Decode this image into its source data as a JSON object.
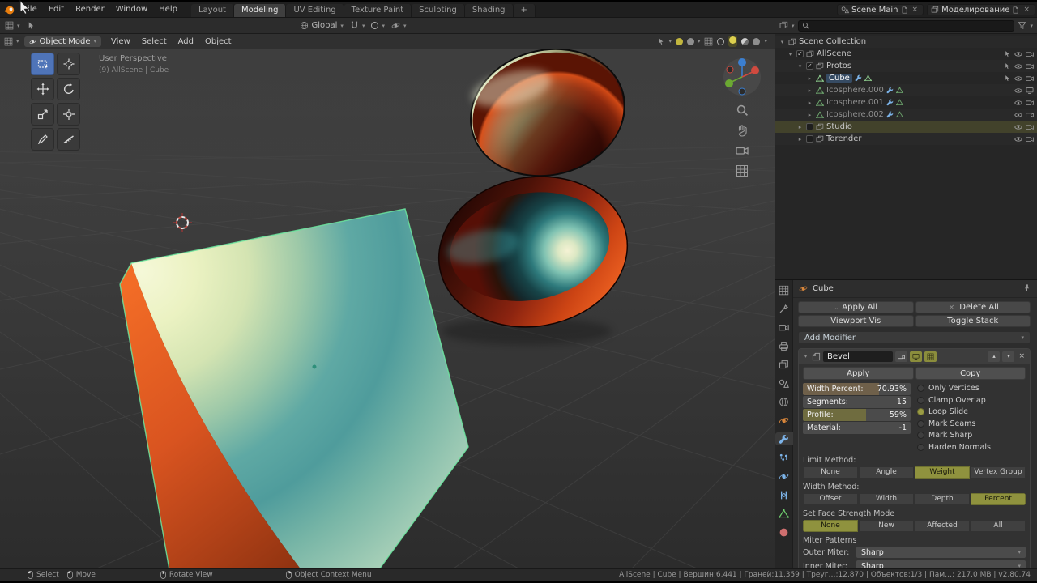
{
  "colors": {
    "active_tool": "#4f74b8",
    "olive_active": "#8f923e",
    "selection_outline": "#6ce8a0",
    "object_orange": "#d8863b",
    "tab_blue": "#7cb3e8"
  },
  "topbar": {
    "menus": [
      "File",
      "Edit",
      "Render",
      "Window",
      "Help"
    ],
    "workspaces": [
      "Layout",
      "Modeling",
      "UV Editing",
      "Texture Paint",
      "Sculpting",
      "Shading",
      "+"
    ],
    "scene_label": "Scene Main",
    "layer_label": "Моделирование"
  },
  "tool_settings": {
    "orientation": "Global"
  },
  "viewport": {
    "mode": "Object Mode",
    "menus": [
      "View",
      "Select",
      "Add",
      "Object"
    ],
    "overlay_line1": "User Perspective",
    "overlay_line2": "(9) AllScene | Cube"
  },
  "outliner": {
    "rows": [
      {
        "label": "Scene Collection"
      },
      {
        "label": "AllScene"
      },
      {
        "label": "Protos"
      },
      {
        "label": "Cube"
      },
      {
        "label": "Icosphere.000"
      },
      {
        "label": "Icosphere.001"
      },
      {
        "label": "Icosphere.002"
      },
      {
        "label": "Studio"
      },
      {
        "label": "Torender"
      }
    ]
  },
  "properties": {
    "breadcrumb": "Cube",
    "apply_all": "Apply All",
    "delete_all": "Delete All",
    "viewport_vis": "Viewport Vis",
    "toggle_stack": "Toggle Stack",
    "add_modifier": "Add Modifier",
    "modifier": {
      "name": "Bevel",
      "apply": "Apply",
      "copy": "Copy",
      "width_label": "Width Percent:",
      "width_value": "70.93%",
      "segments_label": "Segments:",
      "segments_value": "15",
      "profile_label": "Profile:",
      "profile_value": "59%",
      "material_label": "Material:",
      "material_value": "-1",
      "checkboxes": [
        "Only Vertices",
        "Clamp Overlap",
        "Loop Slide",
        "Mark Seams",
        "Mark Sharp",
        "Harden Normals"
      ],
      "limit_label": "Limit Method:",
      "limit_options": [
        "None",
        "Angle",
        "Weight",
        "Vertex Group"
      ],
      "width_method_label": "Width Method:",
      "width_method_options": [
        "Offset",
        "Width",
        "Depth",
        "Percent"
      ],
      "face_strength_label": "Set Face Strength Mode",
      "face_strength_options": [
        "None",
        "New",
        "Affected",
        "All"
      ],
      "miter_label": "Miter Patterns",
      "outer_miter_label": "Outer Miter:",
      "outer_miter_value": "Sharp",
      "inner_miter_label": "Inner Miter:",
      "inner_miter_value": "Sharp"
    }
  },
  "statusbar": {
    "hint_select": "Select",
    "hint_move": "Move",
    "hint_rotate": "Rotate View",
    "hint_context": "Object Context Menu",
    "stats": "AllScene | Cube | Вершин:6,441 | Граней:11,359 | Треуг…:12,870 | Объектов:1/3 | Пам…: 217.0 MB | v2.80.74"
  }
}
